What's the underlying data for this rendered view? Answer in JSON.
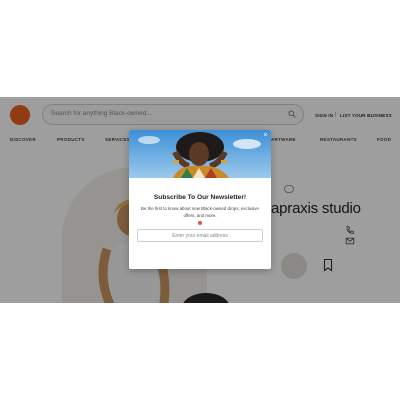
{
  "header": {
    "search_placeholder": "Search for anything Black-owned...",
    "sign_in": "SIGN IN",
    "separator": "|",
    "list_business": "LIST YOUR BUSINESS"
  },
  "nav": {
    "items": [
      "DISCOVER",
      "PRODUCTS",
      "SERVICES",
      "",
      "",
      "",
      "",
      "ARTWARE",
      "RESTAURANTS",
      "FOOD"
    ]
  },
  "store": {
    "category_tag": "",
    "title_visible": "apraxis studio"
  },
  "modal": {
    "title": "Subscribe To Our Newsletter!",
    "description": "Be the first to know about new Black-owned drops, exclusive offers, and more.",
    "email_placeholder": "Enter your email address",
    "close_label": "×"
  },
  "colors": {
    "brand_orange": "#e8621e",
    "overlay": "rgba(0,0,0,0.38)",
    "dot_accent": "#d9534f"
  },
  "icons": {
    "search": "search-icon",
    "phone": "phone-icon",
    "email": "email-icon",
    "bookmark": "bookmark-icon",
    "close": "close-icon"
  }
}
